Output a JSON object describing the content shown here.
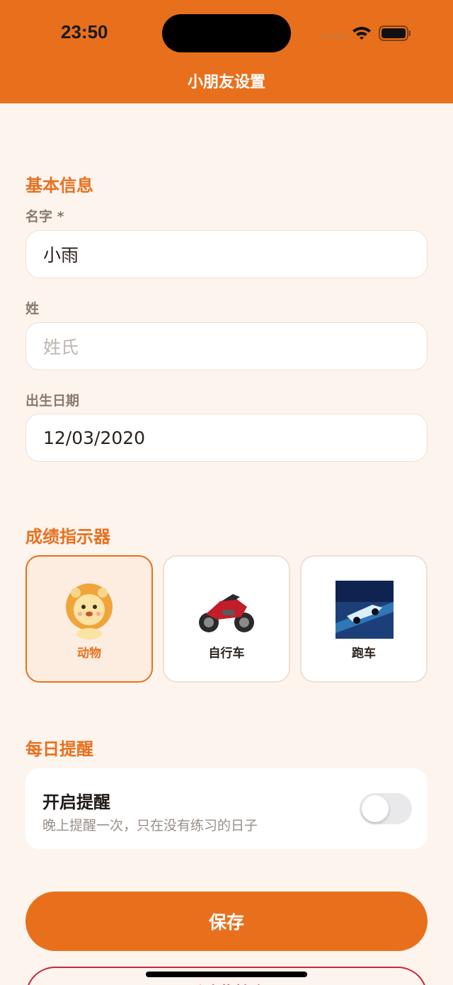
{
  "status_bar": {
    "time": "23:50"
  },
  "header": {
    "title": "小朋友设置"
  },
  "basic_info": {
    "section_title": "基本信息",
    "first_name": {
      "label": "名字 *",
      "value": "小雨"
    },
    "last_name": {
      "label": "姓",
      "placeholder": "姓氏"
    },
    "birth_date": {
      "label": "出生日期",
      "value": "12/03/2020"
    }
  },
  "indicator": {
    "section_title": "成绩指示器",
    "options": [
      {
        "label": "动物",
        "icon": "lion-icon",
        "selected": true
      },
      {
        "label": "自行车",
        "icon": "motorcycle-icon",
        "selected": false
      },
      {
        "label": "跑车",
        "icon": "race-car-icon",
        "selected": false
      }
    ]
  },
  "reminder": {
    "section_title": "每日提醒",
    "title": "开启提醒",
    "subtitle": "晚上提醒一次，只在没有练习的日子",
    "enabled": false
  },
  "actions": {
    "save_label": "保存",
    "delete_label": "删除此档案"
  },
  "colors": {
    "accent": "#E8701D",
    "background": "#FDF4EE",
    "danger": "#C8283A"
  }
}
